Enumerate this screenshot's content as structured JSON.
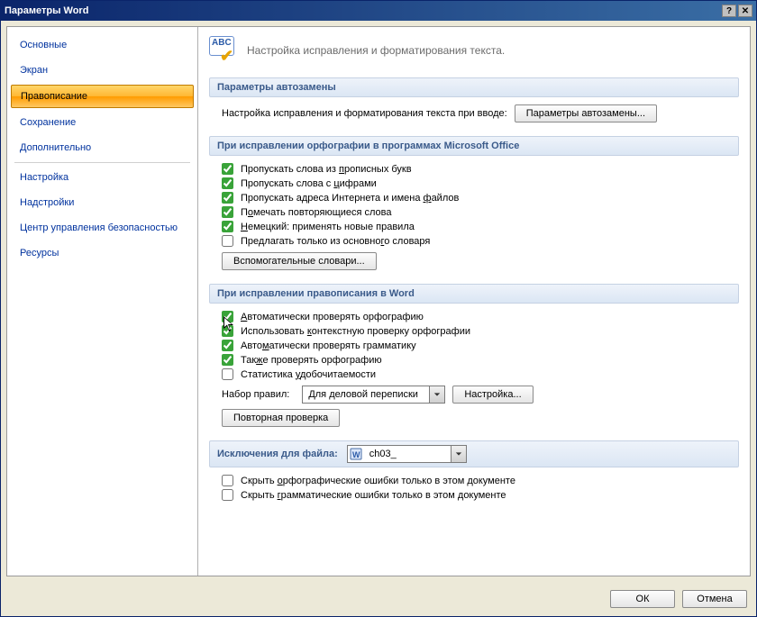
{
  "window": {
    "title": "Параметры Word"
  },
  "sidebar": {
    "items": [
      {
        "label": "Основные"
      },
      {
        "label": "Экран"
      },
      {
        "label": "Правописание",
        "selected": true
      },
      {
        "label": "Сохранение"
      },
      {
        "label": "Дополнительно"
      },
      {
        "label": "Настройка"
      },
      {
        "label": "Надстройки"
      },
      {
        "label": "Центр управления безопасностью"
      },
      {
        "label": "Ресурсы"
      }
    ]
  },
  "header": {
    "icon_label": "ABC",
    "subtitle": "Настройка исправления и форматирования текста."
  },
  "sections": {
    "autocorrect": {
      "title": "Параметры автозамены",
      "desc": "Настройка исправления и форматирования текста при вводе:",
      "button": "Параметры автозамены..."
    },
    "office_spelling": {
      "title": "При исправлении орфографии в программах Microsoft Office",
      "items": [
        {
          "label_pre": "Пропускать слова из ",
          "hot": "п",
          "label_post": "рописных букв",
          "checked": true
        },
        {
          "label_pre": "Пропускать слова с ",
          "hot": "ц",
          "label_post": "ифрами",
          "checked": true
        },
        {
          "label_pre": "Пропускать адреса Интернета и имена ",
          "hot": "ф",
          "label_post": "айлов",
          "checked": true
        },
        {
          "label_pre": "П",
          "hot": "о",
          "label_post": "мечать повторяющиеся слова",
          "checked": true
        },
        {
          "label_pre": "",
          "hot": "Н",
          "label_post": "емецкий: применять новые правила",
          "checked": true
        },
        {
          "label_pre": "Предлагать только из основно",
          "hot": "г",
          "label_post": "о словаря",
          "checked": false
        }
      ],
      "dict_button": "Вспомогательные словари..."
    },
    "word_spelling": {
      "title": "При исправлении правописания в Word",
      "items": [
        {
          "label_pre": "",
          "hot": "А",
          "label_post": "втоматически проверять орфографию",
          "checked": true,
          "cursor": true
        },
        {
          "label_pre": "Использовать ",
          "hot": "к",
          "label_post": "онтекстную проверку орфографии",
          "checked": true
        },
        {
          "label_pre": "Авто",
          "hot": "м",
          "label_post": "атически проверять грамматику",
          "checked": true
        },
        {
          "label_pre": "Так",
          "hot": "ж",
          "label_post": "е проверять орфографию",
          "checked": true
        },
        {
          "label_pre": "Статистика ",
          "hot": "у",
          "label_post": "добочитаемости",
          "checked": false
        }
      ],
      "ruleset_label": "Набор правил:",
      "ruleset_value": "Для деловой переписки",
      "settings_button": "Настройка...",
      "recheck_button": "Повторная проверка"
    },
    "exceptions": {
      "title": "Исключения для файла:",
      "file_value": "ch03_",
      "items": [
        {
          "label_pre": "Скрыть ",
          "hot": "о",
          "label_post": "рфографические ошибки только в этом документе",
          "checked": false
        },
        {
          "label_pre": "Скрыть ",
          "hot": "г",
          "label_post": "рамматические ошибки только в этом документе",
          "checked": false
        }
      ]
    }
  },
  "footer": {
    "ok": "ОК",
    "cancel": "Отмена"
  }
}
